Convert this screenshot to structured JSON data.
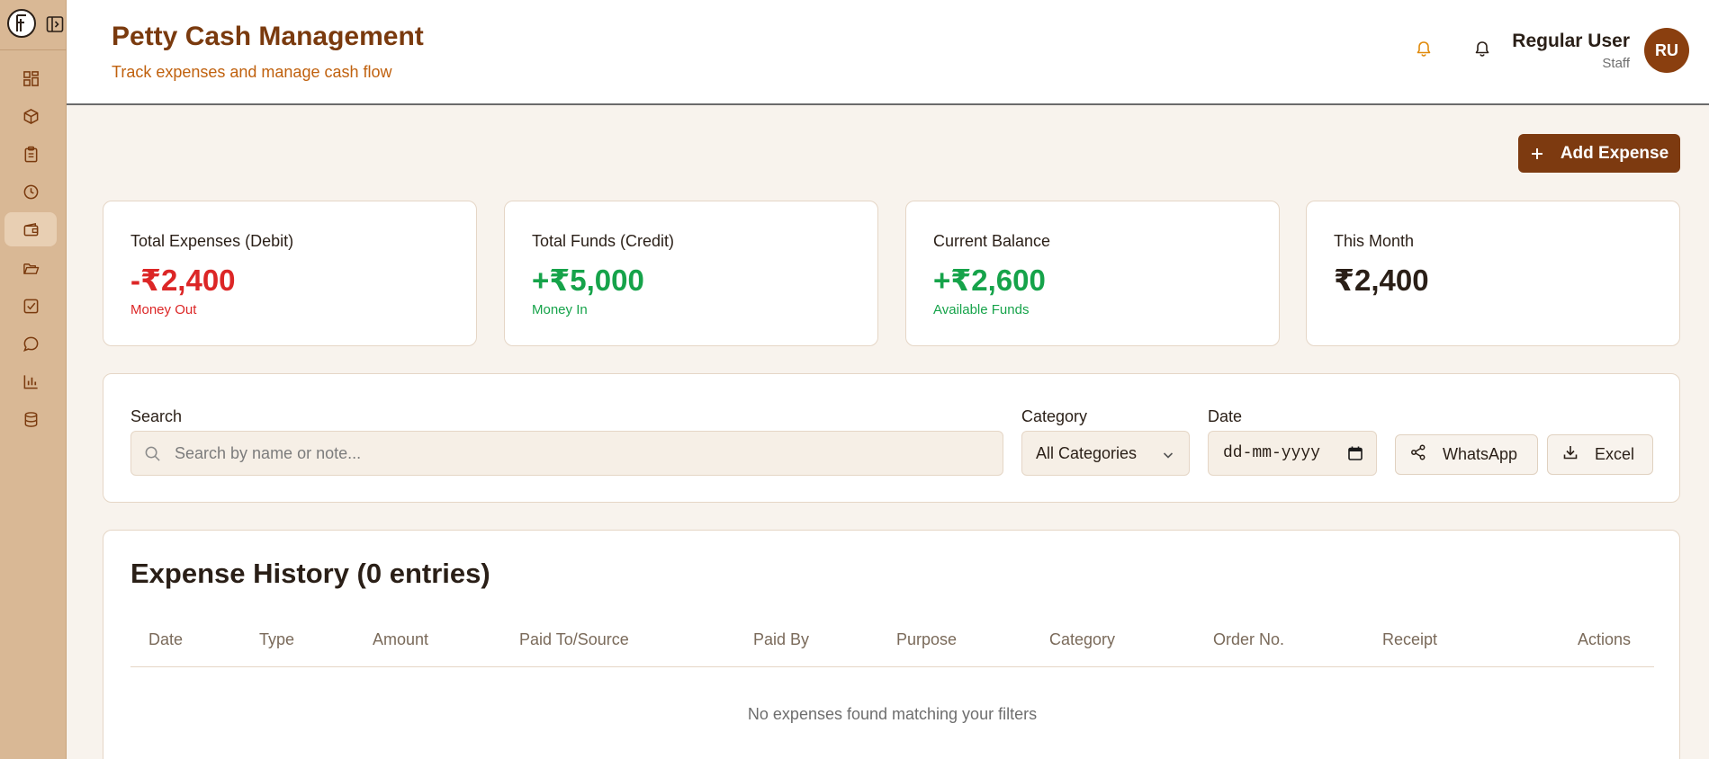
{
  "sidebar": {
    "logo_icon": "f-logo-icon",
    "items": [
      {
        "icon": "dashboard-icon"
      },
      {
        "icon": "box-icon"
      },
      {
        "icon": "clipboard-icon"
      },
      {
        "icon": "clock-icon"
      },
      {
        "icon": "wallet-icon",
        "active": true
      },
      {
        "icon": "folder-icon"
      },
      {
        "icon": "check-square-icon"
      },
      {
        "icon": "chat-icon"
      },
      {
        "icon": "bar-chart-icon"
      },
      {
        "icon": "database-icon"
      }
    ]
  },
  "header": {
    "title": "Petty Cash Management",
    "subtitle": "Track expenses and manage cash flow",
    "user_name": "Regular User",
    "user_role": "Staff",
    "avatar_initials": "RU"
  },
  "actions": {
    "add_expense_label": "Add Expense"
  },
  "stats": [
    {
      "label": "Total Expenses (Debit)",
      "value": "-₹2,400",
      "note": "Money Out"
    },
    {
      "label": "Total Funds (Credit)",
      "value": "+₹5,000",
      "note": "Money In"
    },
    {
      "label": "Current Balance",
      "value": "+₹2,600",
      "note": "Available Funds"
    },
    {
      "label": "This Month",
      "value": "₹2,400"
    }
  ],
  "filters": {
    "search_label": "Search",
    "search_placeholder": "Search by name or note...",
    "category_label": "Category",
    "category_value": "All Categories",
    "date_label": "Date",
    "date_placeholder": "dd-mm-yyyy",
    "whatsapp_label": "WhatsApp",
    "excel_label": "Excel"
  },
  "history": {
    "title": "Expense History (0 entries)",
    "columns": [
      "Date",
      "Type",
      "Amount",
      "Paid To/Source",
      "Paid By",
      "Purpose",
      "Category",
      "Order No.",
      "Receipt",
      "Actions"
    ],
    "empty_message": "No expenses found matching your filters"
  },
  "colors": {
    "brand": "#7d3a10",
    "sidebar": "#d9b895",
    "background": "#f8f3ed",
    "debit": "#dc2626",
    "credit": "#16a34a",
    "notification_accent": "#e08a0b"
  }
}
